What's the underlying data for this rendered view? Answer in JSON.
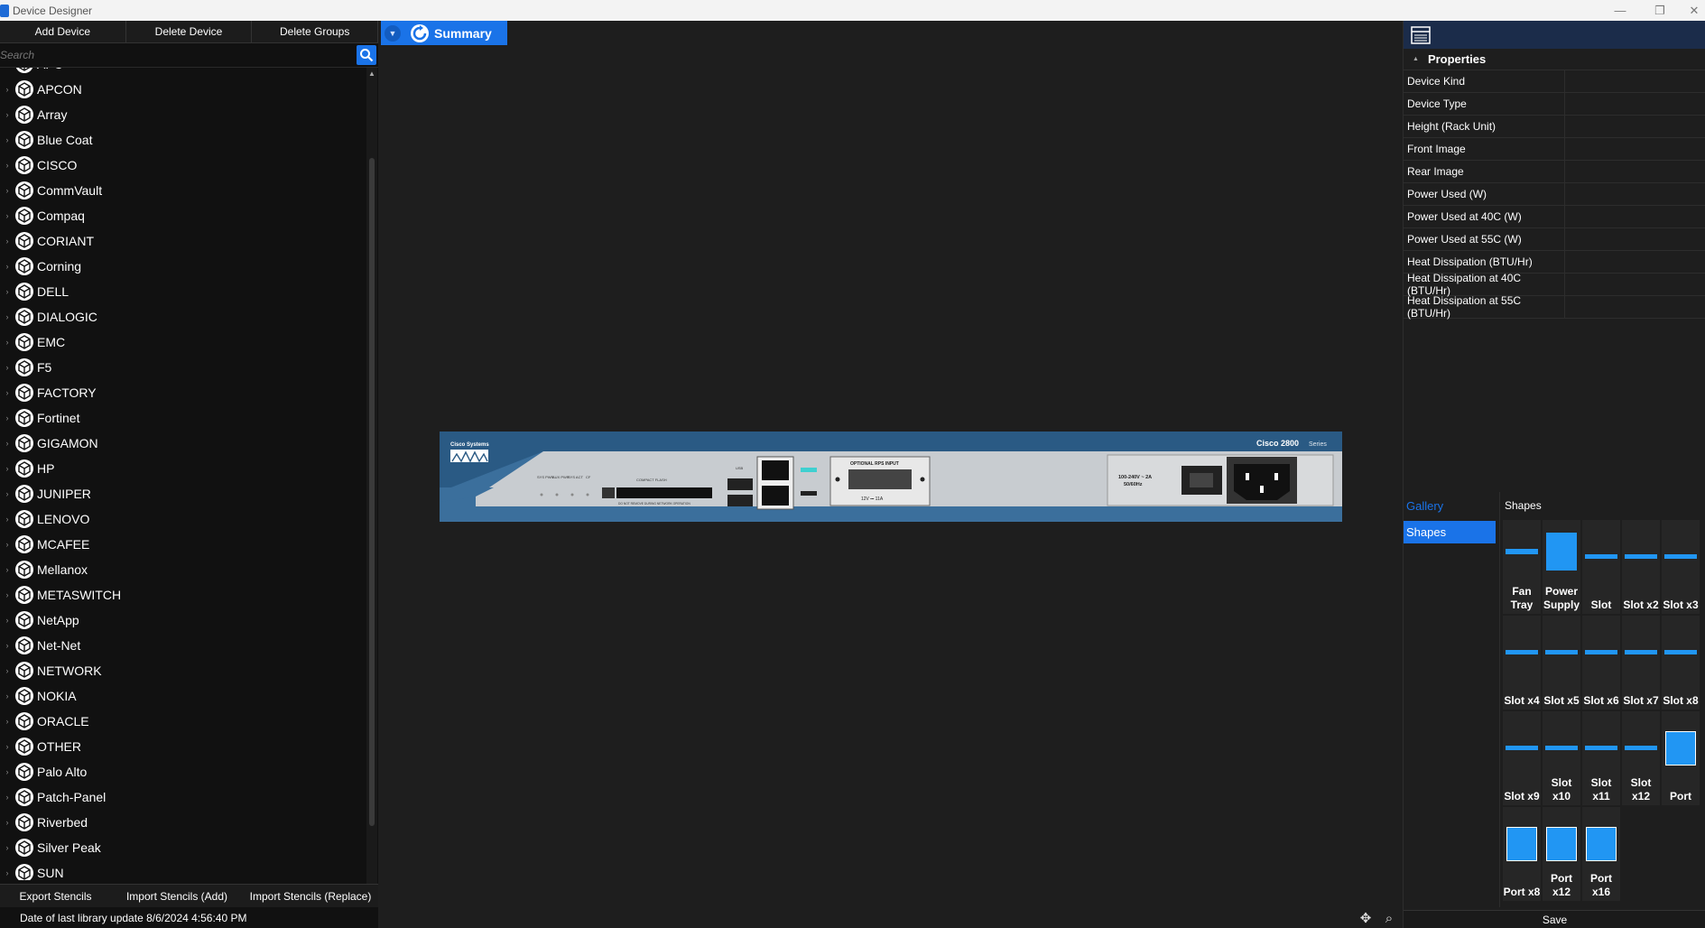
{
  "window": {
    "title": "Device Designer"
  },
  "toolbar": {
    "add": "Add Device",
    "delete": "Delete Device",
    "delete_groups": "Delete Groups"
  },
  "search": {
    "placeholder": "Search"
  },
  "vendors": [
    "APC",
    "APCON",
    "Array",
    "Blue Coat",
    "CISCO",
    "CommVault",
    "Compaq",
    "CORIANT",
    "Corning",
    "DELL",
    "DIALOGIC",
    "EMC",
    "F5",
    "FACTORY",
    "Fortinet",
    "GIGAMON",
    "HP",
    "JUNIPER",
    "LENOVO",
    "MCAFEE",
    "Mellanox",
    "METASWITCH",
    "NetApp",
    "Net-Net",
    "NETWORK",
    "NOKIA",
    "ORACLE",
    "OTHER",
    "Palo Alto",
    "Patch-Panel",
    "Riverbed",
    "Silver Peak",
    "SUN"
  ],
  "bottom": {
    "export": "Export Stencils",
    "import_add": "Import Stencils (Add)",
    "import_replace": "Import Stencils (Replace)"
  },
  "status": {
    "last_update": "Date of last library update 8/6/2024 4:56:40 PM"
  },
  "summary": {
    "label": "Summary"
  },
  "device": {
    "brand": "Cisco Systems",
    "model": "Cisco 2800",
    "series": "Series",
    "led_labels": [
      "SYS PWR",
      "AUX PWR",
      "SYS ACT",
      "CF"
    ],
    "cf_label": "COMPACT FLASH",
    "cf_warning": "DO NOT REMOVE DURING NETWORK OPERATION",
    "usb_label": "USB",
    "console_label": "CONSOLE",
    "aux_label": "AUX",
    "rps_title": "OPTIONAL RPS INPUT",
    "rps_rating": "12V ⎓ 11A",
    "power_rating_1": "100-240V ~ 2A",
    "power_rating_2": "50/60Hz"
  },
  "properties": {
    "header": "Properties",
    "rows": [
      "Device Kind",
      "Device Type",
      "Height (Rack Unit)",
      "Front Image",
      "Rear Image",
      "Power Used (W)",
      "Power Used at 40C (W)",
      "Power Used at 55C (W)",
      "Heat Dissipation (BTU/Hr)",
      "Heat Dissipation at 40C (BTU/Hr)",
      "Heat Dissipation at 55C (BTU/Hr)"
    ]
  },
  "gallery": {
    "title": "Gallery",
    "category": "Shapes",
    "shapes_title": "Shapes",
    "shapes": [
      {
        "label": "Fan Tray",
        "kind": "bar"
      },
      {
        "label": "Power Supply",
        "kind": "block"
      },
      {
        "label": "Slot",
        "kind": "thin"
      },
      {
        "label": "Slot x2",
        "kind": "thin"
      },
      {
        "label": "Slot x3",
        "kind": "thin"
      },
      {
        "label": "Slot x4",
        "kind": "thin"
      },
      {
        "label": "Slot x5",
        "kind": "thin"
      },
      {
        "label": "Slot x6",
        "kind": "thin"
      },
      {
        "label": "Slot x7",
        "kind": "thin"
      },
      {
        "label": "Slot x8",
        "kind": "thin"
      },
      {
        "label": "Slot x9",
        "kind": "thin"
      },
      {
        "label": "Slot x10",
        "kind": "thin"
      },
      {
        "label": "Slot x11",
        "kind": "thin"
      },
      {
        "label": "Slot x12",
        "kind": "thin"
      },
      {
        "label": "Port",
        "kind": "square"
      },
      {
        "label": "Port x8",
        "kind": "square"
      },
      {
        "label": "Port x12",
        "kind": "square"
      },
      {
        "label": "Port x16",
        "kind": "square"
      }
    ]
  },
  "save": {
    "label": "Save"
  },
  "colors": {
    "accent": "#1a73e8",
    "background": "#1e1e1e",
    "device_blue": "#2a5a84",
    "device_grey": "#c8ccd0"
  }
}
